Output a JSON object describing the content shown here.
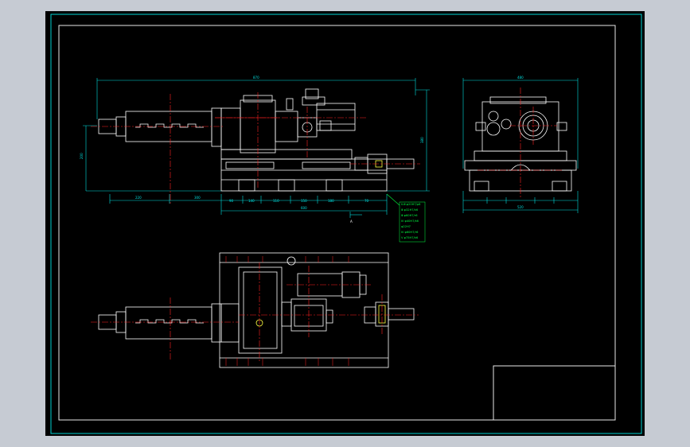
{
  "colors": {
    "window_bg": "#c6cbd3",
    "canvas": "#000000",
    "frame": "#00d2d2",
    "outline": "#ffffff",
    "centerline": "#ff2020",
    "dimension": "#00e0e0",
    "note": "#00ff40",
    "accent": "#ffff40"
  },
  "dimensions": {
    "front_overall": "870",
    "front_height": "380",
    "front_left_height": "200",
    "front_seg1": "220",
    "front_seg2": "300",
    "front_seg3": "90",
    "front_seg4": "140",
    "front_seg5": "110",
    "front_seg6": "150",
    "front_seg7": "180",
    "front_seg8": "70",
    "front_base": "600",
    "side_top": "480",
    "side_bottom": "520",
    "section_mark": "A"
  },
  "notes": [
    "Ⅱ-Ⅲ φ20H7/p6",
    "Ⅲ φ32H7/k6",
    "Ⅲ φ60H7/r6",
    "Ⅳ φ40H7/k6",
    "φ22H7",
    "Ⅳ φ60H7/r6",
    "Ⅴ φ75H7/k6"
  ]
}
